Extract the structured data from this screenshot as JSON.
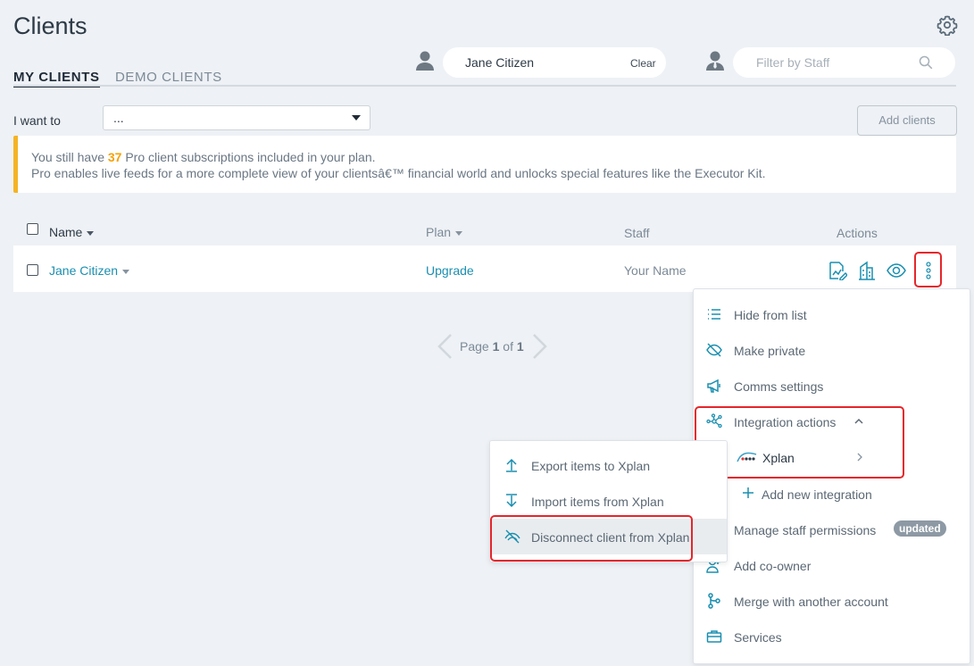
{
  "page": {
    "title": "Clients"
  },
  "tabs": [
    {
      "label": "MY CLIENTS"
    },
    {
      "label": "DEMO CLIENTS"
    }
  ],
  "client_filter": {
    "value": "Jane Citizen",
    "clear_label": "Clear"
  },
  "staff_filter": {
    "placeholder": "Filter by Staff"
  },
  "i_want_to": {
    "label": "I want to",
    "selected": "..."
  },
  "add_clients": {
    "label": "Add clients"
  },
  "notice": {
    "line1_pre": "You still have ",
    "line1_count": "37",
    "line1_post": " Pro client subscriptions included in your plan.",
    "line2": "Pro enables live feeds for a more complete view of your clientsâ€™ financial world and unlocks special features like the Executor Kit.",
    "accent_color": "#f5b325"
  },
  "table": {
    "headers": {
      "name": "Name",
      "plan": "Plan",
      "staff": "Staff",
      "actions": "Actions"
    },
    "rows": [
      {
        "name": "Jane Citizen",
        "plan": "Upgrade",
        "staff": "Your Name"
      }
    ]
  },
  "pagination": {
    "prefix": "Page ",
    "current": "1",
    "sep": " of ",
    "total": "1"
  },
  "actions_menu": {
    "items": [
      {
        "label": "Hide from list",
        "icon": "list-icon"
      },
      {
        "label": "Make private",
        "icon": "eye-slash-icon"
      },
      {
        "label": "Comms settings",
        "icon": "megaphone-icon"
      },
      {
        "label": "Integration actions",
        "icon": "integration-icon"
      },
      {
        "label": "Xplan",
        "icon": "xplan-logo"
      },
      {
        "label": "Add new integration",
        "icon": "plus-icon"
      },
      {
        "label": "Manage staff permissions",
        "icon": "none",
        "badge": "updated"
      },
      {
        "label": "Add co-owner",
        "icon": "add-user-icon"
      },
      {
        "label": "Merge with another account",
        "icon": "merge-icon"
      },
      {
        "label": "Services",
        "icon": "briefcase-icon"
      }
    ]
  },
  "xplan_submenu": {
    "items": [
      {
        "label": "Export items to Xplan",
        "icon": "arrow-up-icon"
      },
      {
        "label": "Import items from Xplan",
        "icon": "arrow-down-icon"
      },
      {
        "label": "Disconnect client from Xplan",
        "icon": "disconnect-icon"
      }
    ]
  },
  "colors": {
    "accent": "#1a8fb0",
    "highlight_border": "#e5262b",
    "background": "#eef1f5"
  }
}
